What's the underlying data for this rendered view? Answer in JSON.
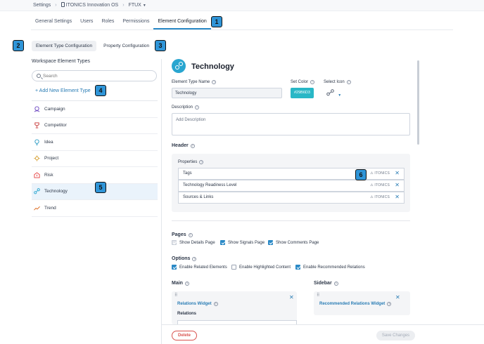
{
  "breadcrumb": {
    "root": "Settings",
    "workspace": "ITONICS Innovation OS",
    "current": "FTUX"
  },
  "tabs": [
    "General Settings",
    "Users",
    "Roles",
    "Permissions",
    "Element Configuration"
  ],
  "subtabs": [
    "Element Type Configuration",
    "Property Configuration"
  ],
  "badges": [
    "1",
    "2",
    "3",
    "4",
    "5",
    "6"
  ],
  "sidebar": {
    "title": "Workspace Element Types",
    "search_placeholder": "Search",
    "add_label": "+ Add New Element Type",
    "items": [
      {
        "label": "Campaign",
        "icon": "campaign-icon"
      },
      {
        "label": "Competitor",
        "icon": "trophy-icon"
      },
      {
        "label": "Idea",
        "icon": "lightbulb-icon"
      },
      {
        "label": "Project",
        "icon": "gear-icon"
      },
      {
        "label": "Risk",
        "icon": "risk-icon"
      },
      {
        "label": "Technology",
        "icon": "technology-icon"
      },
      {
        "label": "Trend",
        "icon": "trend-icon"
      }
    ]
  },
  "detail": {
    "title": "Technology",
    "type_name_label": "Element Type Name",
    "type_name_value": "Technology",
    "set_color_label": "Set Color",
    "color_value": "#29B6D3",
    "select_icon_label": "Select Icon",
    "description_label": "Description",
    "description_placeholder": "Add Description",
    "header_label": "Header",
    "properties_label": "Properties",
    "properties": [
      {
        "name": "Tags",
        "source": "ITONICS"
      },
      {
        "name": "Technology Readiness Level",
        "source": "ITONICS"
      },
      {
        "name": "Sources & Links",
        "source": "ITONICS"
      }
    ],
    "pages_label": "Pages",
    "pages": [
      {
        "label": "Show Details Page",
        "state": "disabled"
      },
      {
        "label": "Show Signals Page",
        "state": "checked"
      },
      {
        "label": "Show Comments Page",
        "state": "checked"
      }
    ],
    "options_label": "Options",
    "options": [
      {
        "label": "Enable Related Elements",
        "state": "checked"
      },
      {
        "label": "Enable Highlighted Content",
        "state": "unchecked"
      },
      {
        "label": "Enable Recommended Relations",
        "state": "checked"
      }
    ],
    "main_label": "Main",
    "sidebar_label": "Sidebar",
    "main_widget": "Relations Widget",
    "main_widget_sub": "Relations",
    "sidebar_widget": "Recommended Relations Widget"
  },
  "footer": {
    "delete_label": "Delete",
    "save_label": "Save Changes"
  },
  "colors": {
    "accent": "#2A89C6",
    "badge": "#2F95D8",
    "technology": "#29B6D3",
    "danger": "#D9534F"
  }
}
